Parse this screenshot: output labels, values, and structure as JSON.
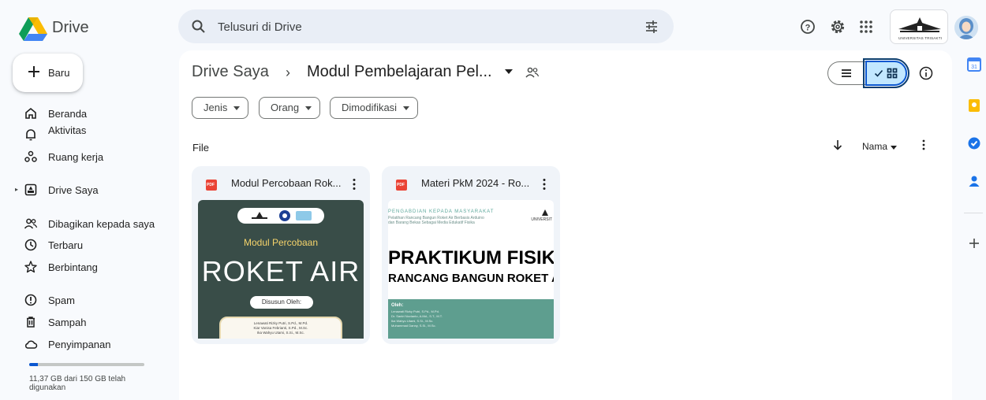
{
  "app": {
    "name": "Drive"
  },
  "search": {
    "placeholder": "Telusuri di Drive"
  },
  "header": {
    "org_text": "UNIVERSITAS TRISAKTI"
  },
  "sidebar": {
    "new_label": "Baru",
    "items": [
      {
        "label": "Beranda"
      },
      {
        "label": "Aktivitas"
      },
      {
        "label": "Ruang kerja"
      },
      {
        "label": "Drive Saya"
      },
      {
        "label": "Dibagikan kepada saya"
      },
      {
        "label": "Terbaru"
      },
      {
        "label": "Berbintang"
      },
      {
        "label": "Spam"
      },
      {
        "label": "Sampah"
      },
      {
        "label": "Penyimpanan"
      }
    ],
    "storage": {
      "text": "11,37 GB dari 150 GB telah digunakan",
      "used_fraction": 0.076
    }
  },
  "main": {
    "breadcrumb": {
      "root": "Drive Saya",
      "separator": "›",
      "current": "Modul Pembelajaran Pel..."
    },
    "filters": [
      {
        "label": "Jenis"
      },
      {
        "label": "Orang"
      },
      {
        "label": "Dimodifikasi"
      }
    ],
    "section_label": "File",
    "sort": {
      "label": "Nama"
    },
    "files": [
      {
        "title": "Modul Percobaan Rok...",
        "type_badge": "PDF",
        "thumb": {
          "subtitle": "Modul Percobaan",
          "title": "ROKET AIR",
          "by_label": "Disusun Oleh:",
          "authors": [
            "Lenawati Rizky Putri, S.Pd., M.Pd.",
            "Kiar Vanisa Febrianti, S.Pd., M.Sc.",
            "Ika Wahyu Utami, S.Si., M.Sc."
          ]
        }
      },
      {
        "title": "Materi PkM 2024 - Ro...",
        "type_badge": "PDF",
        "thumb": {
          "heading": "PENGABDIAN KEPADA MASYARAKAT",
          "subheading1": "Pelatihan Rancang Bangun Roket Air Berbasis Arduino",
          "subheading2": "dan Barang Bekas Sebagai Media Edukatif Fisika",
          "univ": "UNIVERSIT",
          "title1": "PRAKTIKUM FISIK",
          "title2": "RANCANG BANGUN ROKET A",
          "by_label": "Oleh:",
          "authors": [
            "Lenawati Rizky Putri, S.Pd., M.Pd.",
            "Dr. Santri Novianto, A.Md., S.T., M.T.",
            "Ika Wahyu Utami, S.Si., M.Sc.",
            "Muhammad Danny, S.Si., M.Sc."
          ]
        }
      }
    ]
  },
  "colors": {
    "accent": "#0b57d0",
    "selected_bg": "#c2e7ff",
    "panel_bg": "#f8fafd",
    "thumb1_bg": "#394d48",
    "thumb2_band": "#5e9e8f"
  },
  "icons": {
    "header": [
      "search-icon",
      "filter-tune-icon",
      "help-icon",
      "settings-icon",
      "apps-grid-icon"
    ],
    "side_panel": [
      "calendar-icon",
      "keep-icon",
      "tasks-icon",
      "contacts-icon",
      "add-icon"
    ]
  }
}
